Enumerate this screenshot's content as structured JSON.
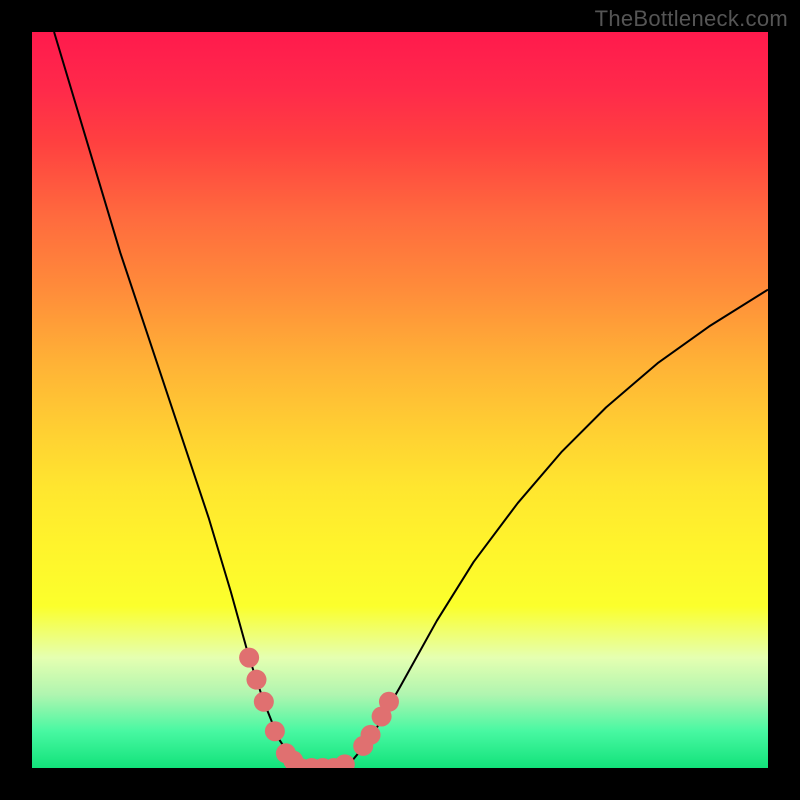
{
  "watermark": {
    "text": "TheBottleneck.com"
  },
  "chart_data": {
    "type": "line",
    "title": "",
    "xlabel": "",
    "ylabel": "",
    "xlim": [
      0,
      100
    ],
    "ylim": [
      0,
      100
    ],
    "grid": false,
    "legend": false,
    "annotations": [],
    "background": "rainbow-vertical-gradient (red top to green bottom)",
    "series": [
      {
        "name": "left-descending-curve",
        "note": "steep convex curve descending from top-left toward trough near x≈37",
        "x": [
          3,
          6,
          9,
          12,
          15,
          18,
          21,
          24,
          27,
          29.5,
          31.5,
          33.5,
          35.5
        ],
        "y": [
          100,
          90,
          80,
          70,
          61,
          52,
          43,
          34,
          24,
          15,
          9,
          4,
          1
        ]
      },
      {
        "name": "trough-flat",
        "note": "near-flat valley segment at bottom",
        "x": [
          35.5,
          38,
          41,
          43.5
        ],
        "y": [
          1,
          0,
          0,
          1
        ]
      },
      {
        "name": "right-ascending-curve",
        "note": "concave curve rising from trough toward upper-right, flattening",
        "x": [
          43.5,
          46,
          50,
          55,
          60,
          66,
          72,
          78,
          85,
          92,
          100
        ],
        "y": [
          1,
          4,
          11,
          20,
          28,
          36,
          43,
          49,
          55,
          60,
          65
        ]
      },
      {
        "name": "marker-dots-left-slope",
        "note": "salmon/pink highlighted dots along the left slope near the valley",
        "color": "#e07070",
        "x": [
          29.5,
          30.5,
          31.5,
          33,
          34.5,
          35.5
        ],
        "y": [
          15,
          12,
          9,
          5,
          2,
          1
        ]
      },
      {
        "name": "marker-dots-trough",
        "note": "salmon/pink highlighted dots along the flat valley",
        "color": "#e07070",
        "x": [
          36.5,
          38,
          39.5,
          41,
          42.5
        ],
        "y": [
          0,
          0,
          0,
          0,
          0.5
        ]
      },
      {
        "name": "marker-dots-right-slope",
        "note": "salmon/pink highlighted dots on right slope just past valley",
        "color": "#e07070",
        "x": [
          45,
          46,
          47.5,
          48.5
        ],
        "y": [
          3,
          4.5,
          7,
          9
        ]
      }
    ]
  }
}
